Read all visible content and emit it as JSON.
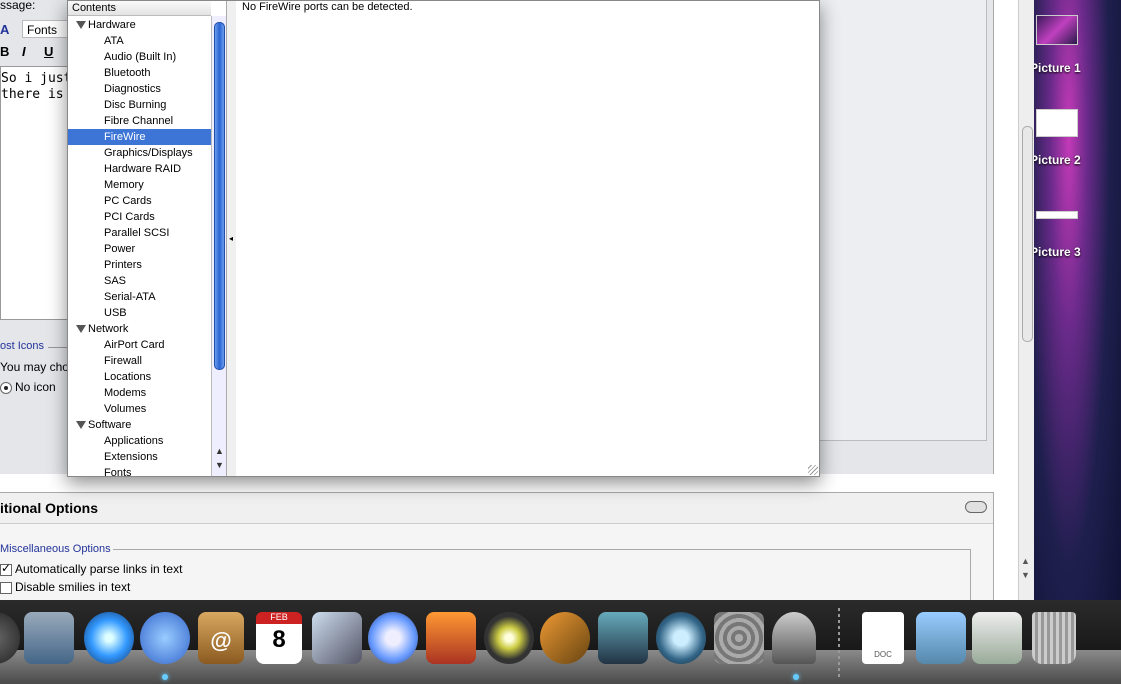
{
  "browser": {
    "message_label": "ssage:",
    "fonts_button": "Fonts",
    "format_buttons": [
      "B",
      "I",
      "U"
    ],
    "message_text": [
      "So i just bo",
      "there is a d"
    ],
    "post_icons_title": "ost Icons",
    "post_icons_desc": "You may cho",
    "no_icon_label": "No icon",
    "additional_options_title": "itional Options",
    "misc_options_title": "Miscellaneous Options",
    "options": [
      {
        "label": "Automatically parse links in text",
        "checked": true
      },
      {
        "label": "Disable smilies in text",
        "checked": false
      }
    ]
  },
  "profiler": {
    "contents_header": "Contents",
    "categories": [
      {
        "name": "Hardware",
        "items": [
          "ATA",
          "Audio (Built In)",
          "Bluetooth",
          "Diagnostics",
          "Disc Burning",
          "Fibre Channel",
          "FireWire",
          "Graphics/Displays",
          "Hardware RAID",
          "Memory",
          "PC Cards",
          "PCI Cards",
          "Parallel SCSI",
          "Power",
          "Printers",
          "SAS",
          "Serial-ATA",
          "USB"
        ]
      },
      {
        "name": "Network",
        "items": [
          "AirPort Card",
          "Firewall",
          "Locations",
          "Modems",
          "Volumes"
        ]
      },
      {
        "name": "Software",
        "items": [
          "Applications",
          "Extensions",
          "Fonts"
        ]
      }
    ],
    "selected_item": "FireWire",
    "detail_text": "No FireWire ports can be detected."
  },
  "desktop": {
    "icons": [
      "Picture 1",
      "Picture 2",
      "Picture 3"
    ]
  },
  "dock": {
    "items": [
      "finder",
      "mail",
      "safari",
      "ichat",
      "address-book",
      "ical",
      "preview",
      "itunes",
      "iphoto",
      "imovie",
      "garageband",
      "dashboard",
      "time-machine",
      "system-preferences",
      "system-profiler",
      "documents",
      "applications",
      "downloads",
      "trash"
    ],
    "ical_month": "FEB",
    "ical_day": "8",
    "doc_label": "DOC"
  }
}
